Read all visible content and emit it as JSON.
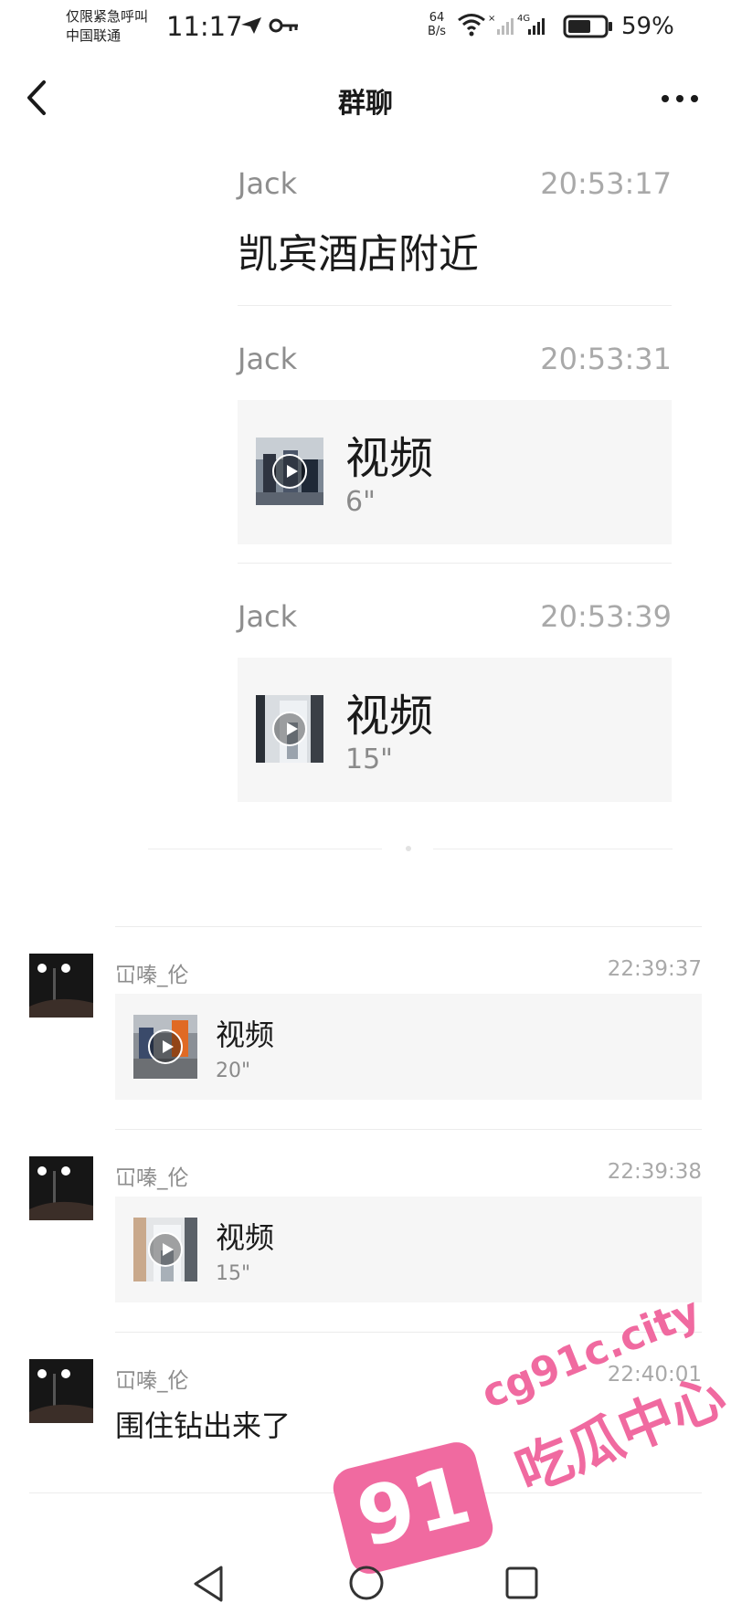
{
  "status_bar": {
    "carrier_line1": "仅限紧急呼叫",
    "carrier_line2": "中国联通",
    "time": "11:17",
    "speed_value": "64",
    "speed_unit": "B/s",
    "network": "4G",
    "battery": "59%"
  },
  "nav": {
    "title": "群聊"
  },
  "forwarded": [
    {
      "sender": "Jack",
      "time": "20:53:17",
      "text": "凯宾酒店附近"
    },
    {
      "sender": "Jack",
      "time": "20:53:31",
      "label": "视频",
      "duration": "6\""
    },
    {
      "sender": "Jack",
      "time": "20:53:39",
      "label": "视频",
      "duration": "15\""
    }
  ],
  "records": [
    {
      "sender": "冚嗪_伦",
      "time": "22:39:37",
      "label": "视频",
      "duration": "20\""
    },
    {
      "sender": "冚嗪_伦",
      "time": "22:39:38",
      "label": "视频",
      "duration": "15\""
    },
    {
      "sender": "冚嗪_伦",
      "time": "22:40:01",
      "text": "围住钻出来了"
    }
  ],
  "watermark": {
    "logo": "91",
    "url": "cg91c.city",
    "name": "吃瓜中心"
  }
}
